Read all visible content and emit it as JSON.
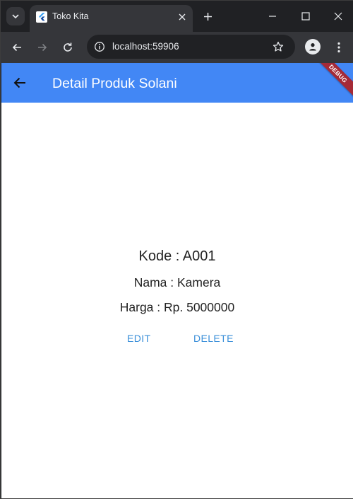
{
  "browser": {
    "tab": {
      "title": "Toko Kita"
    },
    "address": {
      "url": "localhost:59906"
    }
  },
  "app": {
    "appbar": {
      "title": "Detail Produk Solani",
      "debug_label": "DEBUG"
    },
    "product": {
      "kode_line": "Kode : A001",
      "nama_line": "Nama : Kamera",
      "harga_line": "Harga : Rp. 5000000"
    },
    "actions": {
      "edit_label": "EDIT",
      "delete_label": "DELETE"
    }
  },
  "colors": {
    "appbar": "#4287f5",
    "action_text": "#3a8fd9",
    "debug_banner": "#a52a37",
    "browser_frame": "#202124",
    "browser_toolbar": "#35363a"
  }
}
